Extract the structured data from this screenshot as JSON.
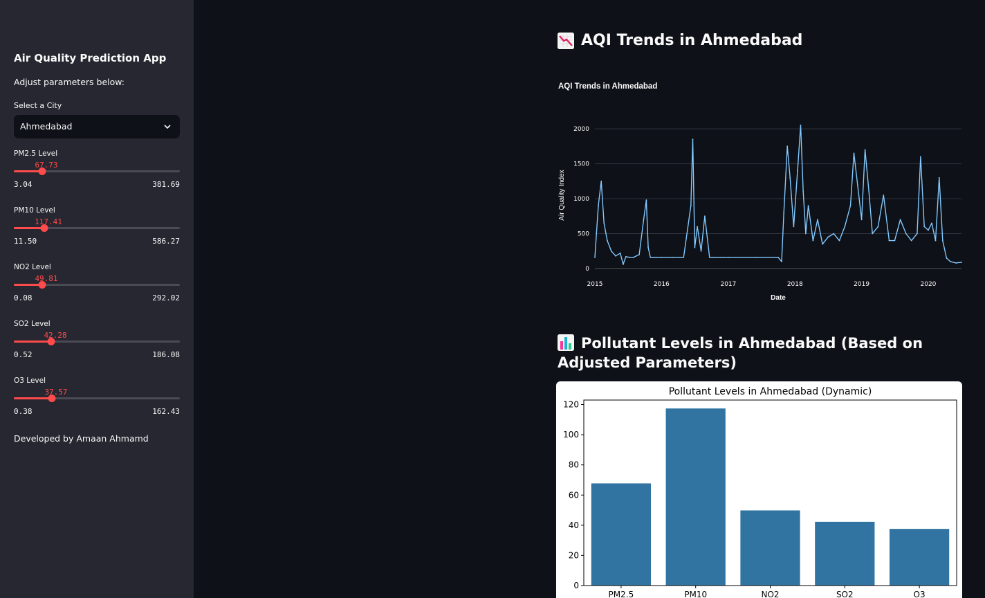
{
  "sidebar": {
    "title": "Air Quality Prediction App",
    "subtitle": "Adjust parameters below:",
    "city_select": {
      "label": "Select a City",
      "value": "Ahmedabad"
    },
    "sliders": [
      {
        "label": "PM2.5 Level",
        "value": "67.73",
        "min": "3.04",
        "max": "381.69",
        "fraction": 0.17
      },
      {
        "label": "PM10 Level",
        "value": "117.41",
        "min": "11.50",
        "max": "586.27",
        "fraction": 0.185
      },
      {
        "label": "NO2 Level",
        "value": "49.81",
        "min": "0.08",
        "max": "292.02",
        "fraction": 0.17
      },
      {
        "label": "SO2 Level",
        "value": "42.28",
        "min": "0.52",
        "max": "186.08",
        "fraction": 0.225
      },
      {
        "label": "O3 Level",
        "value": "37.57",
        "min": "0.38",
        "max": "162.43",
        "fraction": 0.23
      }
    ],
    "footer": "Developed by Amaan Ahmamd"
  },
  "main": {
    "aqi_heading": "AQI Trends in Ahmedabad",
    "pollutant_heading": "Pollutant Levels in Ahmedabad (Based on Adjusted Parameters)"
  },
  "colors": {
    "accent": "#ff4b4b",
    "line": "#83c9ff",
    "bar": "#3274a1",
    "sidebar_bg": "#262730",
    "app_bg": "#0e1117"
  },
  "icons": {
    "aqi_heading": "chart-decreasing-icon",
    "pollutant_heading": "bar-chart-icon",
    "select": "chevron-down-icon"
  },
  "chart_data": [
    {
      "type": "line",
      "title": "AQI Trends in Ahmedabad",
      "xlabel": "Date",
      "ylabel": "Air Quality Index",
      "xlim": [
        "2015-01-01",
        "2020-07-01"
      ],
      "ylim": [
        0,
        2100
      ],
      "x_ticks": [
        "2015",
        "2016",
        "2017",
        "2018",
        "2019",
        "2020"
      ],
      "y_ticks": [
        "0",
        "500",
        "1000",
        "1500",
        "2000"
      ],
      "grid": true,
      "x": [
        "2015-01-01",
        "2015-01-20",
        "2015-02-05",
        "2015-02-20",
        "2015-03-10",
        "2015-04-01",
        "2015-04-25",
        "2015-05-20",
        "2015-06-05",
        "2015-06-20",
        "2015-07-10",
        "2015-08-01",
        "2015-09-01",
        "2015-09-25",
        "2015-10-10",
        "2015-10-20",
        "2015-11-01",
        "2015-11-15",
        "2015-12-01",
        "2016-01-01",
        "2016-03-01",
        "2016-05-01",
        "2016-06-10",
        "2016-06-20",
        "2016-07-01",
        "2016-07-15",
        "2016-08-05",
        "2016-08-25",
        "2016-09-20",
        "2016-10-10",
        "2016-11-01",
        "2016-11-20",
        "2016-12-05",
        "2017-01-01",
        "2017-06-01",
        "2017-10-01",
        "2017-10-20",
        "2017-11-01",
        "2017-11-20",
        "2017-12-05",
        "2017-12-25",
        "2018-01-15",
        "2018-02-01",
        "2018-02-15",
        "2018-03-01",
        "2018-03-15",
        "2018-04-10",
        "2018-05-05",
        "2018-06-01",
        "2018-07-01",
        "2018-08-01",
        "2018-09-01",
        "2018-10-01",
        "2018-11-01",
        "2018-11-20",
        "2018-12-10",
        "2019-01-01",
        "2019-01-20",
        "2019-02-10",
        "2019-03-01",
        "2019-04-01",
        "2019-05-01",
        "2019-06-01",
        "2019-07-01",
        "2019-08-01",
        "2019-09-01",
        "2019-10-01",
        "2019-11-01",
        "2019-11-20",
        "2019-12-10",
        "2020-01-01",
        "2020-01-20",
        "2020-02-10",
        "2020-03-01",
        "2020-03-20",
        "2020-04-10",
        "2020-05-01",
        "2020-06-01",
        "2020-07-01"
      ],
      "values": [
        160,
        900,
        1250,
        650,
        400,
        250,
        180,
        220,
        60,
        170,
        160,
        160,
        200,
        700,
        980,
        300,
        160,
        160,
        160,
        160,
        160,
        160,
        900,
        1850,
        300,
        600,
        250,
        750,
        160,
        160,
        160,
        160,
        160,
        160,
        160,
        160,
        100,
        800,
        1750,
        1300,
        600,
        1400,
        2050,
        1100,
        500,
        900,
        400,
        700,
        350,
        450,
        500,
        400,
        600,
        900,
        1650,
        1200,
        700,
        1700,
        1100,
        500,
        600,
        1050,
        400,
        400,
        700,
        500,
        400,
        500,
        1600,
        600,
        550,
        650,
        400,
        1300,
        400,
        150,
        100,
        80,
        90
      ],
      "series_color": "#83c9ff"
    },
    {
      "type": "bar",
      "title": "Pollutant Levels in Ahmedabad (Dynamic)",
      "categories": [
        "PM2.5",
        "PM10",
        "NO2",
        "SO2",
        "O3"
      ],
      "values": [
        67.73,
        117.41,
        49.81,
        42.28,
        37.57
      ],
      "ylim": [
        0,
        123
      ],
      "y_ticks": [
        "0",
        "20",
        "40",
        "60",
        "80",
        "100",
        "120"
      ],
      "grid": false
    }
  ]
}
